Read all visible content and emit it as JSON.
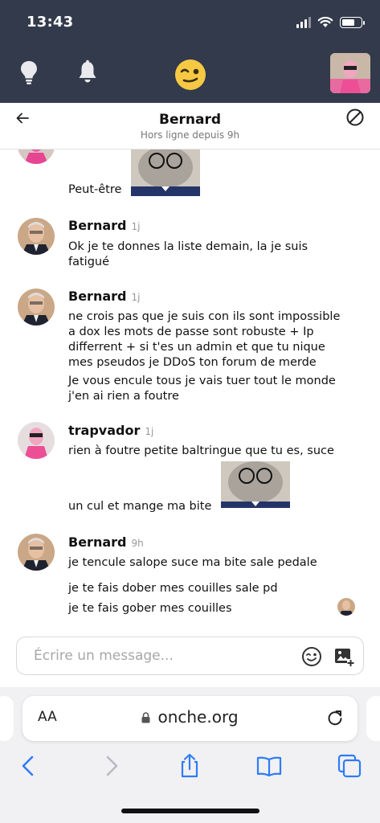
{
  "status_bar": {
    "time": "13:43"
  },
  "icons": {
    "bulb": "lightbulb-icon",
    "bell": "bell-icon",
    "logo": "winking-face-logo",
    "back": "arrow-left-icon",
    "block": "block-icon",
    "emoji": "emoji-icon",
    "image": "image-add-icon",
    "reload": "reload-icon"
  },
  "conversation": {
    "name": "Bernard",
    "status": "Hors ligne depuis 9h"
  },
  "messages": [
    {
      "author": "",
      "time": "",
      "lines": [
        "Peut-être"
      ]
    },
    {
      "author": "Bernard",
      "time": "1j",
      "lines": [
        "Ok je te donnes la liste demain, la je suis",
        "fatigué"
      ]
    },
    {
      "author": "Bernard",
      "time": "1j",
      "lines": [
        "ne crois pas que je suis con ils sont impossible",
        "a dox les mots de passe sont robuste + Ip",
        "differrent + si t'es un admin et que tu nique",
        "mes pseudos je DDoS ton forum de merde",
        "Je vous encule tous je vais tuer tout le monde",
        "j'en ai rien a foutre"
      ]
    },
    {
      "author": "trapvador",
      "time": "1j",
      "lines": [
        "rien à foutre petite baltringue que tu es, suce",
        "un cul et mange ma bite"
      ]
    },
    {
      "author": "Bernard",
      "time": "9h",
      "lines": [
        "je tencule salope suce ma bite sale pedale",
        "je te fais dober mes couilles sale pd",
        "je te fais gober mes couilles"
      ]
    }
  ],
  "composer": {
    "placeholder": "Écrire un message..."
  },
  "browser": {
    "aa_label": "AA",
    "url": "onche.org"
  },
  "colors": {
    "header_bg": "#323a4b",
    "accent": "#2f7cf6"
  }
}
